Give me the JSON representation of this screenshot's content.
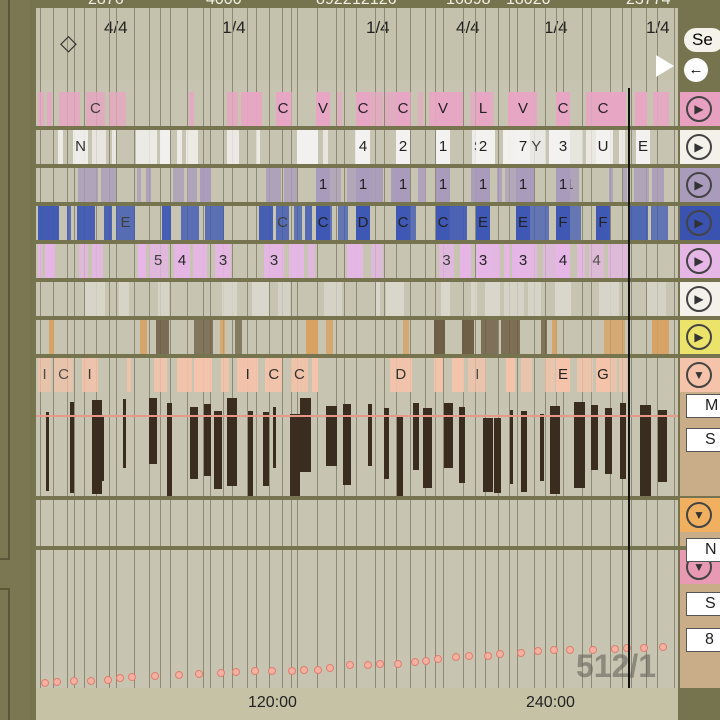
{
  "timeline": {
    "beat_numbers": [
      "2876",
      "4000",
      "8922",
      "12126",
      "16898",
      "18020",
      "23774"
    ],
    "time_signatures": [
      "4/4",
      "1/4",
      "1/4",
      "4/4",
      "1/4",
      "1/4"
    ]
  },
  "ruler": {
    "labels": [
      "120:00",
      "240:00"
    ]
  },
  "watermark": "512/1",
  "right_panel": {
    "search_label": "Se",
    "back_icon": "arrow-left-icon",
    "fields": [
      "M",
      "S",
      "N",
      "S",
      "8"
    ]
  },
  "tracks": [
    {
      "color": "#e7a6c3",
      "button": "#e8a0c0",
      "expanded": false,
      "labels": [
        "C",
        "C",
        "V",
        "C",
        "C",
        "V",
        "L",
        "V",
        "C",
        "C"
      ]
    },
    {
      "color": "#f4f2f0",
      "button": "#f3f1ea",
      "expanded": false,
      "labels": [
        "N",
        "S",
        "Y",
        "4",
        "2",
        "1",
        "2",
        "7",
        "3",
        "U",
        "E"
      ]
    },
    {
      "color": "#a99bbb",
      "button": "#a99bbb",
      "expanded": false,
      "labels": [
        "1",
        "1",
        "1",
        "1",
        "1",
        "1",
        "1",
        "1",
        "1"
      ]
    },
    {
      "color": "#3e58b3",
      "button": "#3a52b0",
      "expanded": false,
      "labels": [
        "E",
        "C",
        "C",
        "D",
        "C",
        "C",
        "E",
        "E",
        "F",
        "F"
      ]
    },
    {
      "color": "#e6b6e6",
      "button": "#e6b6e6",
      "expanded": false,
      "labels": [
        "5",
        "4",
        "3",
        "3",
        "3",
        "4",
        "3",
        "3",
        "4"
      ]
    },
    {
      "color": "#d9d7cc",
      "button": "#f3f1ea",
      "expanded": false,
      "labels": []
    },
    {
      "color": "#d8a060",
      "button": "#ece46a",
      "expanded": false,
      "labels": []
    },
    {
      "color": "#f5c3aa",
      "button": "#f5c3aa",
      "expanded": true,
      "labels": [
        "I",
        "C",
        "I",
        "I",
        "C",
        "C",
        "D",
        "I",
        "E",
        "G"
      ]
    },
    {
      "color": "#c8c5b3",
      "button": "#f0b060",
      "expanded": true,
      "labels": []
    },
    {
      "color": "#c8c5b3",
      "button": "#e89ab5",
      "expanded": true,
      "labels": []
    }
  ]
}
